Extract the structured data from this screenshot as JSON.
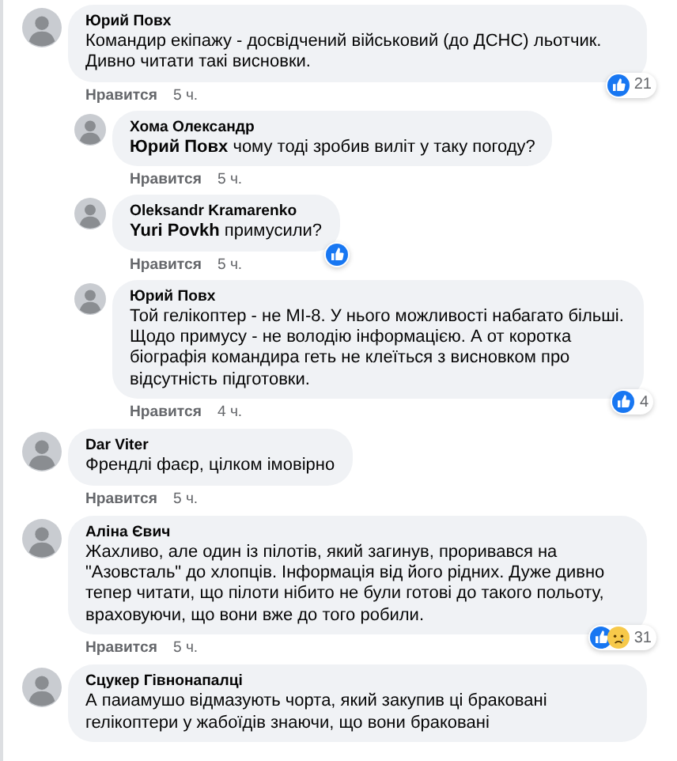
{
  "comments": [
    {
      "author": "Юрий Повх",
      "text": "Командир екіпажу - досвідчений військовий (до ДСНС) льотчик. Дивно читати такі висновки.",
      "reactions": [
        {
          "kind": "like"
        }
      ],
      "reaction_count": "21",
      "actions": {
        "like": "Нравится",
        "time": "5 ч."
      },
      "children": [
        {
          "author": "Хома Олександр",
          "text": "**Юрий Повх** чому тоді зробив виліт у таку погоду?",
          "actions": {
            "like": "Нравится",
            "time": "5 ч."
          }
        },
        {
          "author": "Oleksandr Kramarenko",
          "text": "**Yuri Povkh** примусили?",
          "reactions": [
            {
              "kind": "like"
            }
          ],
          "actions": {
            "like": "Нравится",
            "time": "5 ч."
          }
        },
        {
          "author": "Юрий Повх",
          "text": "Той гелікоптер - не МІ-8. У нього можливості набагато більші. Щодо примусу - не володію інформацією. А от коротка біографія командира геть не клеїться з висновком про відсутність підготовки.",
          "reactions": [
            {
              "kind": "like"
            }
          ],
          "reaction_count": "4",
          "actions": {
            "like": "Нравится",
            "time": "4 ч."
          }
        }
      ]
    },
    {
      "author": "Dar Viter",
      "text": "Френдлі фаєр, цілком імовірно",
      "actions": {
        "like": "Нравится",
        "time": "5 ч."
      }
    },
    {
      "author": "Аліна Євич",
      "text": "Жахливо, але один із пілотів, який загинув, проривався на \"Азовсталь\" до хлопців. Інформація від його рідних. Дуже дивно тепер читати, що пілоти нібито не були готові до такого польоту, враховуючи, що вони вже до того робили.",
      "reactions": [
        {
          "kind": "like"
        },
        {
          "kind": "sad"
        }
      ],
      "reaction_count": "31",
      "actions": {
        "like": "Нравится",
        "time": "5 ч."
      }
    },
    {
      "author": "Сцукер Гівнонапалці",
      "text": "А паиамушо відмазують чорта, який закупив ці браковані гелікоптери у жабоїдів знаючи, що вони браковані"
    }
  ]
}
